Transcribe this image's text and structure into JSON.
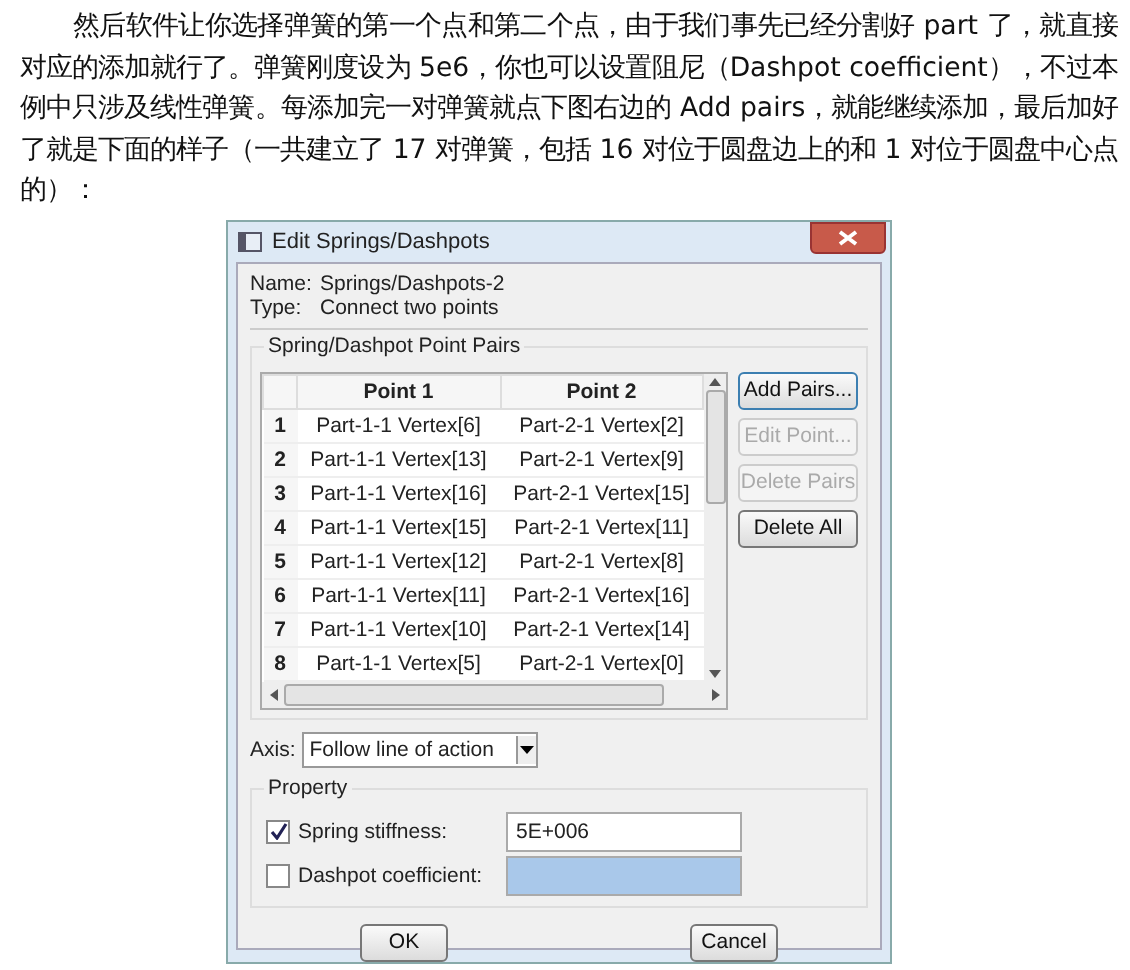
{
  "article": {
    "paragraph": "然后软件让你选择弹簧的第一个点和第二个点，由于我们事先已经分割好 part 了，就直接对应的添加就行了。弹簧刚度设为 5e6，你也可以设置阻尼（Dashpot coefficient），不过本例中只涉及线性弹簧。每添加完一对弹簧就点下图右边的 Add pairs，就能继续添加，最后加好了就是下面的样子（一共建立了 17 对弹簧，包括 16 对位于圆盘边上的和 1 对位于圆盘中心点的）："
  },
  "dialog": {
    "title": "Edit Springs/Dashpots",
    "name": {
      "label": "Name:",
      "value": "Springs/Dashpots-2"
    },
    "type": {
      "label": "Type:",
      "value": "Connect two points"
    },
    "pairs_group": {
      "title": "Spring/Dashpot Point Pairs",
      "columns": [
        "Point 1",
        "Point 2"
      ],
      "rows": [
        {
          "index": "1",
          "point_1": "Part-1-1 Vertex[6]",
          "point_2": "Part-2-1 Vertex[2]"
        },
        {
          "index": "2",
          "point_1": "Part-1-1 Vertex[13]",
          "point_2": "Part-2-1 Vertex[9]"
        },
        {
          "index": "3",
          "point_1": "Part-1-1 Vertex[16]",
          "point_2": "Part-2-1 Vertex[15]"
        },
        {
          "index": "4",
          "point_1": "Part-1-1 Vertex[15]",
          "point_2": "Part-2-1 Vertex[11]"
        },
        {
          "index": "5",
          "point_1": "Part-1-1 Vertex[12]",
          "point_2": "Part-2-1 Vertex[8]"
        },
        {
          "index": "6",
          "point_1": "Part-1-1 Vertex[11]",
          "point_2": "Part-2-1 Vertex[16]"
        },
        {
          "index": "7",
          "point_1": "Part-1-1 Vertex[10]",
          "point_2": "Part-2-1 Vertex[14]"
        },
        {
          "index": "8",
          "point_1": "Part-1-1 Vertex[5]",
          "point_2": "Part-2-1 Vertex[0]"
        }
      ],
      "buttons": [
        {
          "label": "Add Pairs...",
          "disabled": false
        },
        {
          "label": "Edit Point...",
          "disabled": true
        },
        {
          "label": "Delete Pairs",
          "disabled": true
        },
        {
          "label": "Delete All",
          "disabled": false
        }
      ]
    },
    "axis": {
      "label": "Axis:",
      "value": "Follow line of action"
    },
    "property_group": {
      "title": "Property",
      "fields": [
        {
          "label": "Spring stiffness:",
          "checked": true,
          "value": "5E+006"
        },
        {
          "label": "Dashpot coefficient:",
          "checked": false
        }
      ]
    },
    "buttons": [
      "OK",
      "Cancel"
    ]
  }
}
